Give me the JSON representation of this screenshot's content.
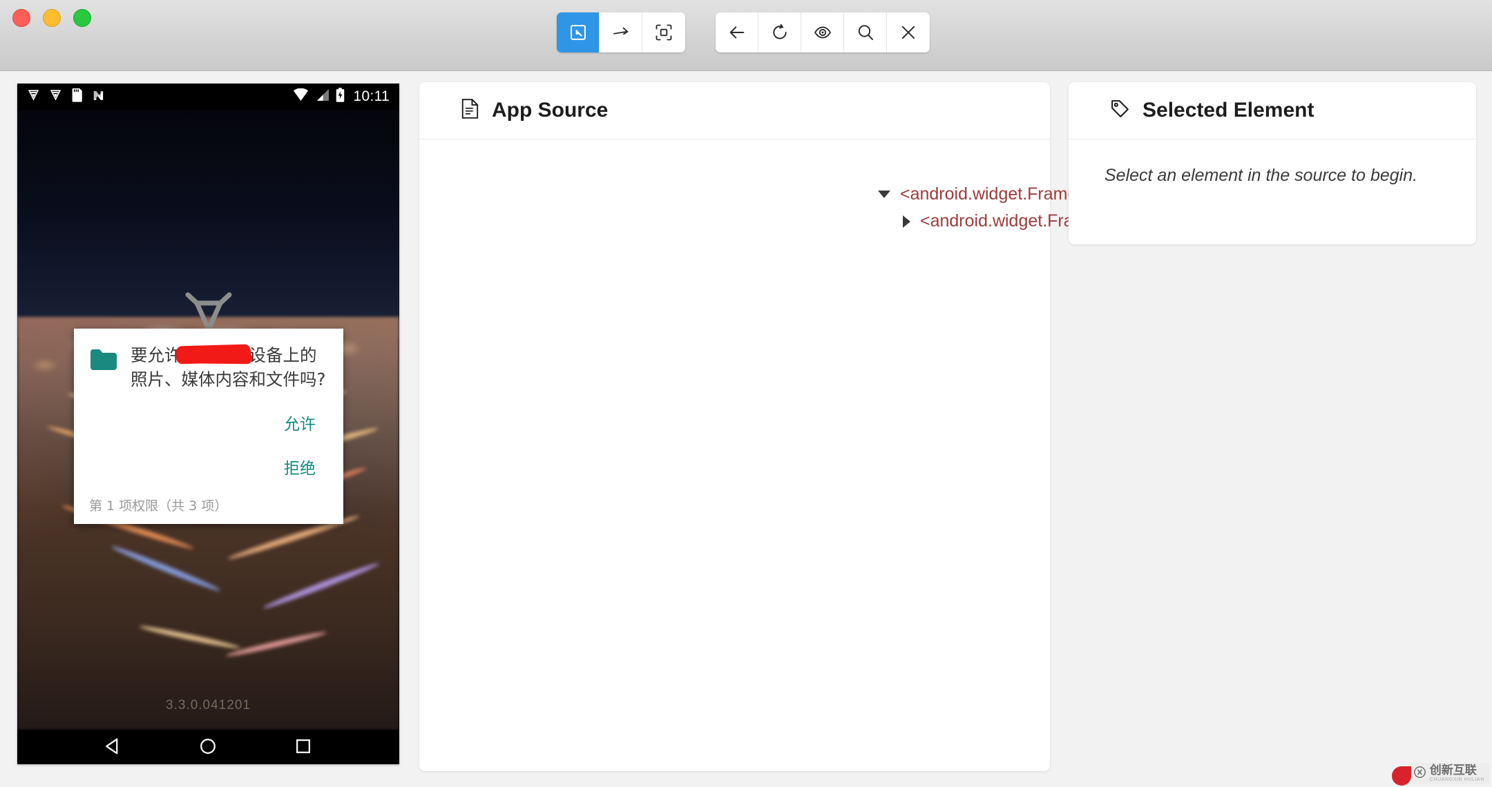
{
  "window": {
    "traffic_lights": [
      {
        "name": "close",
        "color": "#ff5f57"
      },
      {
        "name": "minimize",
        "color": "#febc2e"
      },
      {
        "name": "maximize",
        "color": "#28c840"
      }
    ]
  },
  "toolbar": {
    "accent_color": "#2f95e6",
    "group_left": [
      {
        "icon": "select-element-icon",
        "label": "Select Element",
        "active": true
      },
      {
        "icon": "swipe-icon",
        "label": "Swipe By Coordinates",
        "active": false
      },
      {
        "icon": "tap-icon",
        "label": "Tap By Coordinates",
        "active": false
      }
    ],
    "group_right": [
      {
        "icon": "back-arrow-icon",
        "label": "Back"
      },
      {
        "icon": "refresh-icon",
        "label": "Refresh Source"
      },
      {
        "icon": "eye-icon",
        "label": "Start Recording"
      },
      {
        "icon": "search-icon",
        "label": "Search for Element"
      },
      {
        "icon": "close-x-icon",
        "label": "Quit Session"
      }
    ]
  },
  "device": {
    "status_bar": {
      "left_icons": [
        "download-icon",
        "download-icon",
        "sd-card-icon",
        "netease-n-icon"
      ],
      "right_icons": [
        "wifi-icon",
        "signal-icon",
        "battery-charging-icon"
      ],
      "time": "10:11"
    },
    "app": {
      "version_text": "3.3.0.041201",
      "brand_mark": "bull-logo-icon"
    },
    "permission_dialog": {
      "icon": "folder-icon",
      "icon_color": "#1b8a7e",
      "message_before_redaction": "要允许",
      "message_after_redaction": "动访问您设备上的照片、媒体内容和文件吗?",
      "redaction_color": "#f11a17",
      "allow_label": "允许",
      "deny_label": "拒绝",
      "action_color": "#148a80",
      "footer": "第 1 项权限（共 3 项）"
    },
    "nav_bar": [
      {
        "icon": "android-back-icon",
        "label": "Back"
      },
      {
        "icon": "android-home-icon",
        "label": "Home"
      },
      {
        "icon": "android-recents-icon",
        "label": "Recents"
      }
    ]
  },
  "app_source": {
    "icon": "document-icon",
    "title": "App Source",
    "tree": [
      {
        "level": 0,
        "expanded": true,
        "tag": "<android.widget.FrameLayout>"
      },
      {
        "level": 1,
        "expanded": false,
        "tag": "<android.widget.FrameLayout>"
      }
    ],
    "tag_color": "#9c3c3c"
  },
  "selected_element": {
    "icon": "tag-icon",
    "title": "Selected Element",
    "placeholder": "Select an element in the source to begin."
  },
  "watermark": {
    "name_cn": "创新互联",
    "name_en": "CHUANGXIN HULIAN",
    "logo": "circled-x-icon"
  }
}
